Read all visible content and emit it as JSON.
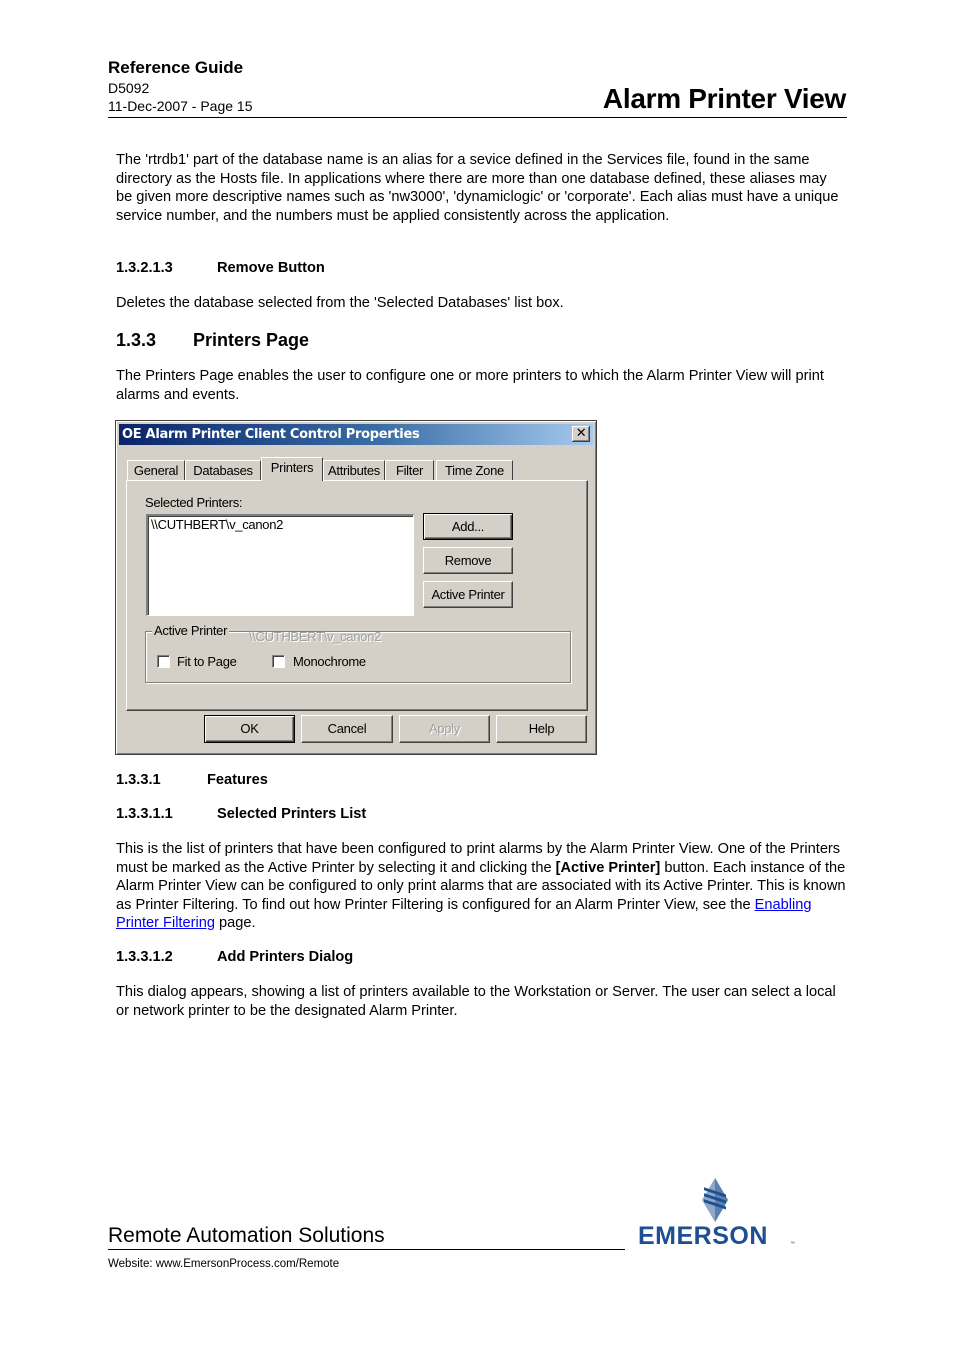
{
  "header": {
    "guide_title": "Reference Guide",
    "doc_number": "D5092",
    "date_page": "11-Dec-2007 - Page 15",
    "section_title": "Alarm Printer View"
  },
  "body": {
    "intro_paragraph": "The 'rtrdb1' part of the database name is an alias for a sevice defined in the Services file, found in the same directory as the Hosts file. In applications where there are more than one database defined, these aliases may be given more descriptive names such as 'nw3000', 'dynamiclogic' or 'corporate'. Each alias must have a unique service number, and the numbers must be applied consistently across the application.",
    "remove_button_heading": {
      "number": "1.3.2.1.3",
      "title": "Remove Button"
    },
    "remove_button_text": "Deletes the database selected from the 'Selected Databases' list box.",
    "printers_page_heading": {
      "number": "1.3.3",
      "title": "Printers Page"
    },
    "printers_page_text": "The Printers Page enables the user to configure one or more printers to which the Alarm Printer View will print alarms and events.",
    "features_heading": {
      "number": "1.3.3.1",
      "title": "Features"
    },
    "selected_printers_heading": {
      "number": "1.3.3.1.1",
      "title": "Selected Printers List"
    },
    "selected_printers_text_1": "This is the list of printers that have been configured to print alarms by the Alarm Printer View.  One of the Printers must be  marked as the Active Printer by selecting it and clicking the ",
    "selected_printers_bold": "[Active Printer]",
    "selected_printers_text_2": " button. Each instance of the Alarm Printer View can be configured to only print alarms that are associated with its Active Printer. This is known as Printer Filtering. To find out how Printer Filtering is configured for an Alarm Printer View, see the ",
    "selected_printers_link": "Enabling Printer Filtering",
    "selected_printers_text_3": " page.",
    "add_printers_heading": {
      "number": "1.3.3.1.2",
      "title": "Add Printers Dialog"
    },
    "add_printers_text": "This dialog appears, showing a list of printers available to the Workstation or Server. The user can select a local or network printer to be the designated Alarm Printer."
  },
  "dialog": {
    "title": "OE Alarm Printer Client Control Properties",
    "close_glyph": "✕",
    "tabs": [
      {
        "label": "General",
        "active": false
      },
      {
        "label": "Databases",
        "active": false
      },
      {
        "label": "Printers",
        "active": true
      },
      {
        "label": "Attributes",
        "active": false
      },
      {
        "label": "Filter",
        "active": false
      },
      {
        "label": "Time Zone",
        "active": false
      }
    ],
    "selected_printers_label": "Selected Printers:",
    "selected_printers": [
      "\\\\CUTHBERT\\v_canon2"
    ],
    "buttons": {
      "add": "Add...",
      "remove": "Remove",
      "active_printer": "Active Printer"
    },
    "active_printer_group": {
      "legend": "Active Printer",
      "value": "\\\\CUTHBERT\\v_canon2",
      "fit_to_page": {
        "label": "Fit to Page",
        "checked": false
      },
      "monochrome": {
        "label": "Monochrome",
        "checked": false
      }
    },
    "footer_buttons": {
      "ok": "OK",
      "cancel": "Cancel",
      "apply": "Apply",
      "help": "Help"
    }
  },
  "footer": {
    "organization": "Remote Automation Solutions",
    "website": "Website:  www.EmersonProcess.com/Remote",
    "logo_text": "EMERSON",
    "logo_tm": "™",
    "brand_color": "#1d4f91"
  }
}
